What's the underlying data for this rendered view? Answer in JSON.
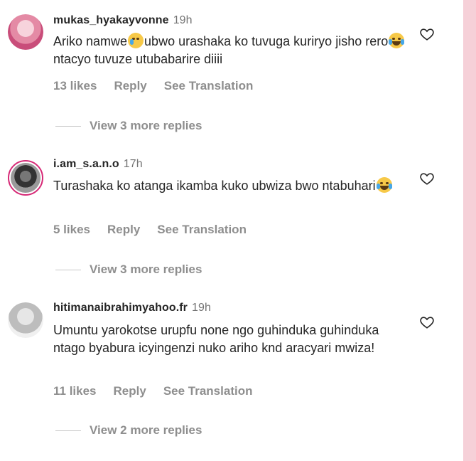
{
  "comments": [
    {
      "username": "mukas_hyakayvonne",
      "time": "19h",
      "text_parts": [
        "Ariko namwe",
        "ubwo urashaka ko tuvuga kuriryo jisho rero",
        "ntacyo tuvuze utubabarire diiii"
      ],
      "likes": "13 likes",
      "reply": "Reply",
      "translate": "See Translation",
      "view_replies": "View 3 more replies"
    },
    {
      "username": "i.am_s.a.n.o",
      "time": "17h",
      "text_parts": [
        "Turashaka ko atanga ikamba kuko ubwiza bwo ntabuhari",
        ""
      ],
      "likes": "5 likes",
      "reply": "Reply",
      "translate": "See Translation",
      "view_replies": "View 3 more replies"
    },
    {
      "username": "hitimanaibrahimyahoo.fr",
      "time": "19h",
      "text": "Umuntu yarokotse urupfu none ngo guhinduka guhinduka ntago byabura icyingenzi nuko ariho knd aracyari mwiza!",
      "likes": "11 likes",
      "reply": "Reply",
      "translate": "See Translation",
      "view_replies": "View 2 more replies"
    }
  ],
  "colors": {
    "username": "#262626",
    "muted": "#8e8e8e",
    "story_ring": "#d62976",
    "side_strip": "#f6d0d8"
  },
  "icons": [
    "heart-outline-icon",
    "crying-face-emoji",
    "tears-of-joy-emoji"
  ]
}
